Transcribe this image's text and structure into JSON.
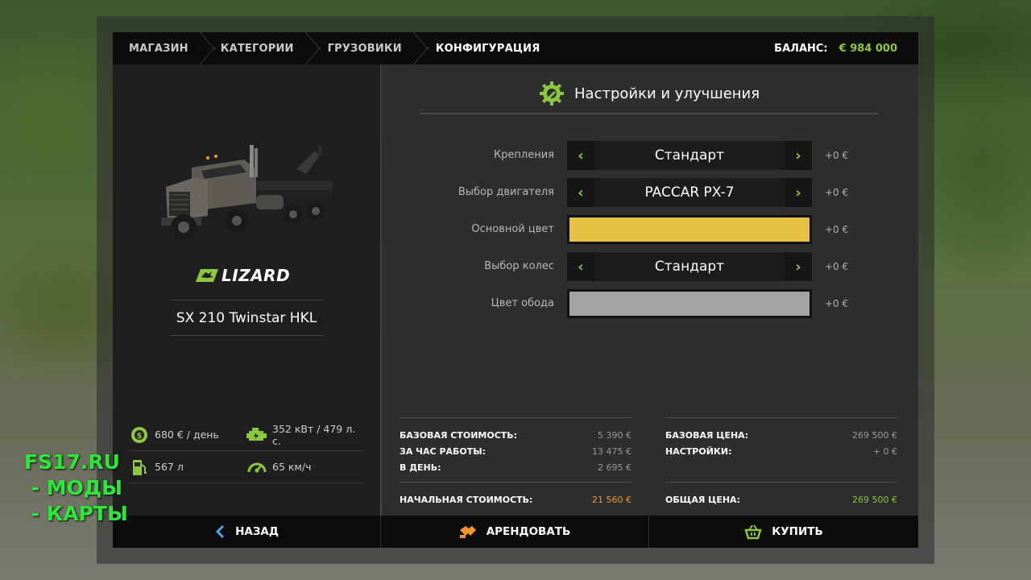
{
  "breadcrumb": [
    "МАГАЗИН",
    "КАТЕГОРИИ",
    "ГРУЗОВИКИ",
    "КОНФИГУРАЦИЯ"
  ],
  "balance": {
    "label": "БАЛАНС:",
    "value": "€ 984 000"
  },
  "vehicle": {
    "brand": "LIZARD",
    "model": "SX 210 Twinstar HKL",
    "stats": {
      "maintenance": "680 € / день",
      "power": "352 кВт / 479 л. с.",
      "fuel": "567 л",
      "speed": "65 км/ч"
    }
  },
  "config": {
    "title": "Настройки и улучшения",
    "options": [
      {
        "label": "Крепления",
        "value": "Стандарт",
        "price": "+0 €"
      },
      {
        "label": "Выбор двигателя",
        "value": "PACCAR PX-7",
        "price": "+0 €"
      },
      {
        "label": "Основной цвет",
        "color": "#e5c243",
        "price": "+0 €"
      },
      {
        "label": "Выбор колес",
        "value": "Стандарт",
        "price": "+0 €"
      },
      {
        "label": "Цвет обода",
        "color": "#a3a3a3",
        "price": "+0 €"
      }
    ]
  },
  "costs": {
    "left": [
      {
        "k": "БАЗОВАЯ СТОИМОСТЬ:",
        "v": "5 390 €"
      },
      {
        "k": "ЗА ЧАС РАБОТЫ:",
        "v": "13 475 €"
      },
      {
        "k": "В ДЕНЬ:",
        "v": "2 695 €"
      }
    ],
    "left_final": {
      "k": "НАЧАЛЬНАЯ СТОИМОСТЬ:",
      "v": "21 560 €"
    },
    "right": [
      {
        "k": "БАЗОВАЯ ЦЕНА:",
        "v": "269 500 €"
      },
      {
        "k": "НАСТРОЙКИ:",
        "v": "+ 0 €"
      }
    ],
    "right_final": {
      "k": "ОБЩАЯ ЦЕНА:",
      "v": "269 500 €"
    }
  },
  "footer": {
    "back": "НАЗАД",
    "lease": "АРЕНДОВАТЬ",
    "buy": "КУПИТЬ"
  },
  "watermark": [
    "FS17.RU",
    " - МОДЫ",
    " - КАРТЫ"
  ],
  "colors": {
    "accent": "#8dc63f",
    "lease_price": "#f0962a",
    "header_bg": "#0c0c0c"
  }
}
